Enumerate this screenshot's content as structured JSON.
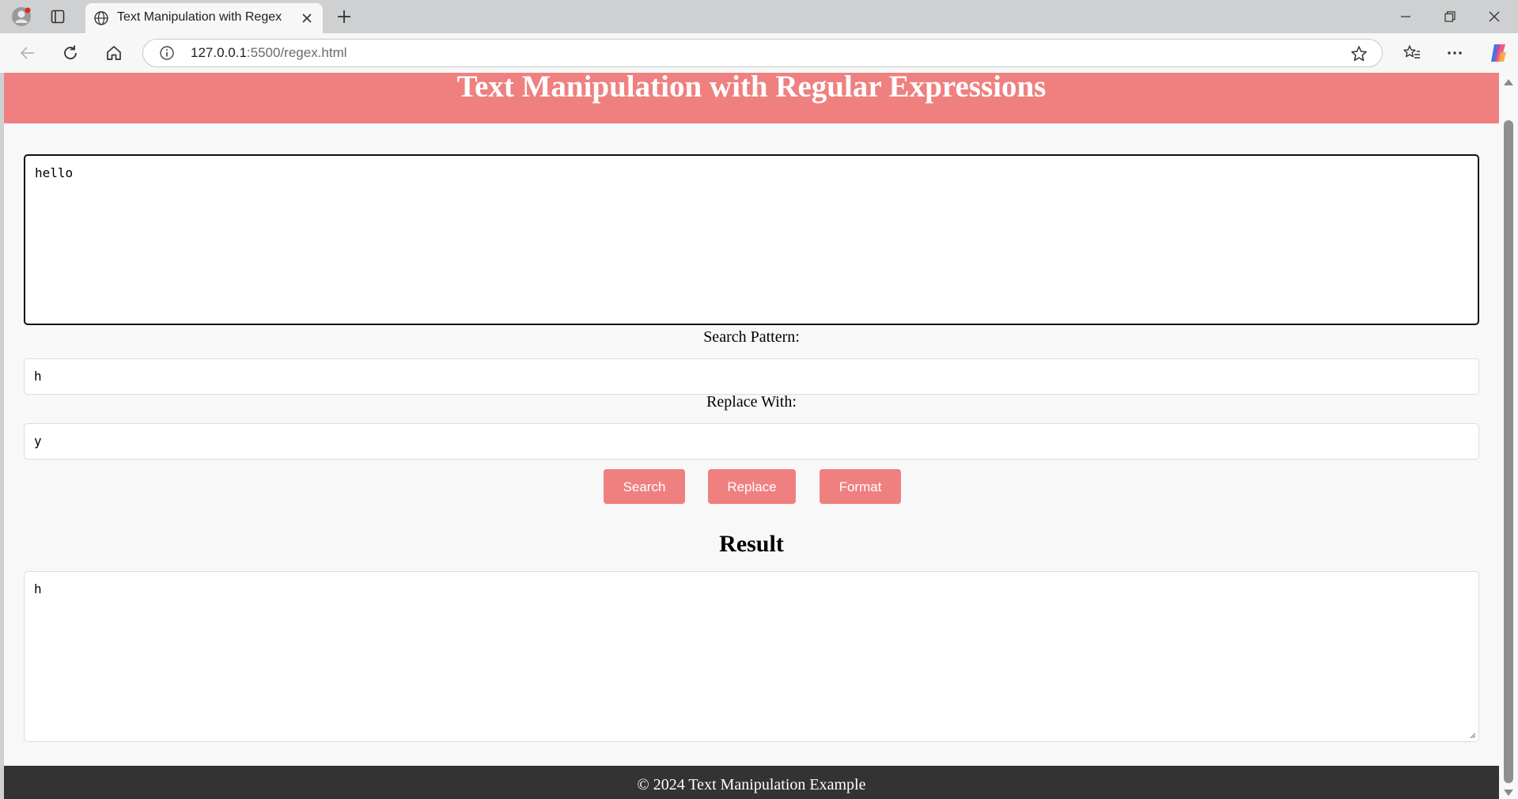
{
  "browser": {
    "tab_title": "Text Manipulation with Regex",
    "url_host": "127.0.0.1",
    "url_rest": ":5500/regex.html"
  },
  "page": {
    "heading": "Text Manipulation with Regular Expressions",
    "input_text": "hello",
    "search_label": "Search Pattern:",
    "search_value": "h",
    "replace_label": "Replace With:",
    "replace_value": "y",
    "buttons": {
      "search": "Search",
      "replace": "Replace",
      "format": "Format"
    },
    "result_title": "Result",
    "result_text": "h",
    "footer": "© 2024 Text Manipulation Example"
  },
  "colors": {
    "accent": "#f08080",
    "footer_bg": "#333333"
  }
}
